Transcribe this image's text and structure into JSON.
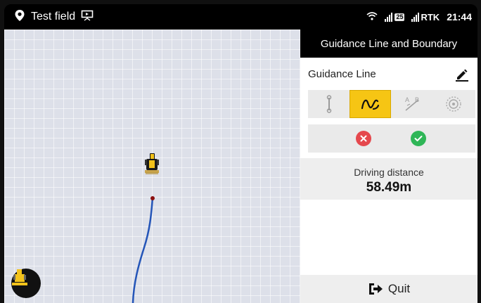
{
  "status_bar": {
    "field_name": "Test field",
    "sim_badge": "25",
    "rtk_label": "RTK",
    "time": "21:44"
  },
  "map": {
    "background_color": "#dde0e9",
    "guidance_line_color": "#2455b8"
  },
  "panel": {
    "title": "Guidance Line and Boundary",
    "guidance_line_label": "Guidance Line",
    "modes": [
      {
        "name": "straight-line",
        "active": false
      },
      {
        "name": "curve",
        "active": true
      },
      {
        "name": "a-b-line",
        "active": false
      },
      {
        "name": "pivot",
        "active": false
      }
    ],
    "distance_label": "Driving distance",
    "distance_value": "58.49m",
    "quit_label": "Quit"
  },
  "colors": {
    "accent": "#f6c514",
    "cancel": "#e5484d",
    "confirm": "#2fb657"
  }
}
